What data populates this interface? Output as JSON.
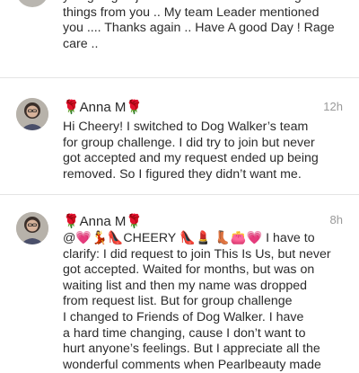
{
  "comments": [
    {
      "text": "you going to join  our team ? I heard a lot good\nthings from you .. My team Leader mentioned\nyou .... Thanks  again .. Have A good Day  ! Rage\ncare .."
    },
    {
      "name": "🌹Anna M🌹",
      "time": "12h",
      "text": "Hi Cheery! I switched to Dog Walker’s team\nfor group challenge. I did try to join but never\ngot accepted and my request ended up being\nremoved. So I figured they didn’t want me."
    },
    {
      "name": "🌹Anna M🌹",
      "time": "8h",
      "text": "@💗💃👠CHEERY 👠💄 👢👛💗 I have to\nclarify: I did request to join This Is Us, but never\ngot accepted. Waited for months, but was on\nwaiting list and then my name was dropped\nfrom request list. But for group challenge\nI changed to Friends of Dog Walker. I have\na hard time changing, cause I don’t want to\nhurt anyone’s feelings. But I appreciate all the\nwonderful comments when Pearlbeauty made"
    }
  ]
}
